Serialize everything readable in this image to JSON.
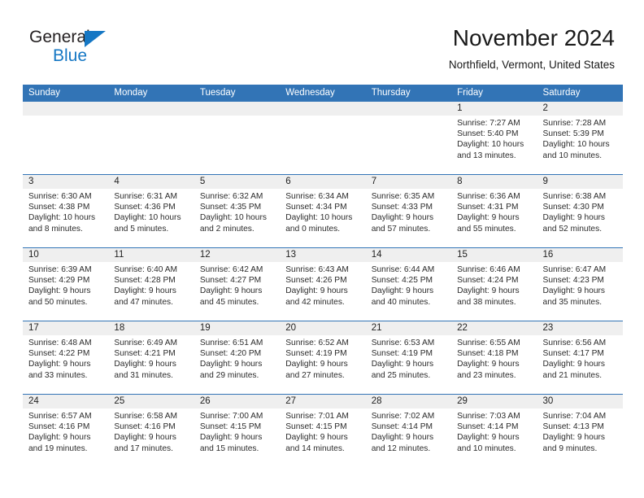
{
  "brand": {
    "name_top": "General",
    "name_bottom": "Blue",
    "color_blue": "#1577c4",
    "color_dark": "#231f20"
  },
  "header": {
    "title": "November 2024",
    "location": "Northfield, Vermont, United States"
  },
  "theme": {
    "header_blue": "#3274b6",
    "day_band_gray": "#efefef",
    "text_dark": "#2b2b2b"
  },
  "weekdays": [
    "Sunday",
    "Monday",
    "Tuesday",
    "Wednesday",
    "Thursday",
    "Friday",
    "Saturday"
  ],
  "weeks": [
    [
      {
        "day": "",
        "empty": true
      },
      {
        "day": "",
        "empty": true
      },
      {
        "day": "",
        "empty": true
      },
      {
        "day": "",
        "empty": true
      },
      {
        "day": "",
        "empty": true
      },
      {
        "day": "1",
        "sunrise": "Sunrise: 7:27 AM",
        "sunset": "Sunset: 5:40 PM",
        "daylight": "Daylight: 10 hours and 13 minutes."
      },
      {
        "day": "2",
        "sunrise": "Sunrise: 7:28 AM",
        "sunset": "Sunset: 5:39 PM",
        "daylight": "Daylight: 10 hours and 10 minutes."
      }
    ],
    [
      {
        "day": "3",
        "sunrise": "Sunrise: 6:30 AM",
        "sunset": "Sunset: 4:38 PM",
        "daylight": "Daylight: 10 hours and 8 minutes."
      },
      {
        "day": "4",
        "sunrise": "Sunrise: 6:31 AM",
        "sunset": "Sunset: 4:36 PM",
        "daylight": "Daylight: 10 hours and 5 minutes."
      },
      {
        "day": "5",
        "sunrise": "Sunrise: 6:32 AM",
        "sunset": "Sunset: 4:35 PM",
        "daylight": "Daylight: 10 hours and 2 minutes."
      },
      {
        "day": "6",
        "sunrise": "Sunrise: 6:34 AM",
        "sunset": "Sunset: 4:34 PM",
        "daylight": "Daylight: 10 hours and 0 minutes."
      },
      {
        "day": "7",
        "sunrise": "Sunrise: 6:35 AM",
        "sunset": "Sunset: 4:33 PM",
        "daylight": "Daylight: 9 hours and 57 minutes."
      },
      {
        "day": "8",
        "sunrise": "Sunrise: 6:36 AM",
        "sunset": "Sunset: 4:31 PM",
        "daylight": "Daylight: 9 hours and 55 minutes."
      },
      {
        "day": "9",
        "sunrise": "Sunrise: 6:38 AM",
        "sunset": "Sunset: 4:30 PM",
        "daylight": "Daylight: 9 hours and 52 minutes."
      }
    ],
    [
      {
        "day": "10",
        "sunrise": "Sunrise: 6:39 AM",
        "sunset": "Sunset: 4:29 PM",
        "daylight": "Daylight: 9 hours and 50 minutes."
      },
      {
        "day": "11",
        "sunrise": "Sunrise: 6:40 AM",
        "sunset": "Sunset: 4:28 PM",
        "daylight": "Daylight: 9 hours and 47 minutes."
      },
      {
        "day": "12",
        "sunrise": "Sunrise: 6:42 AM",
        "sunset": "Sunset: 4:27 PM",
        "daylight": "Daylight: 9 hours and 45 minutes."
      },
      {
        "day": "13",
        "sunrise": "Sunrise: 6:43 AM",
        "sunset": "Sunset: 4:26 PM",
        "daylight": "Daylight: 9 hours and 42 minutes."
      },
      {
        "day": "14",
        "sunrise": "Sunrise: 6:44 AM",
        "sunset": "Sunset: 4:25 PM",
        "daylight": "Daylight: 9 hours and 40 minutes."
      },
      {
        "day": "15",
        "sunrise": "Sunrise: 6:46 AM",
        "sunset": "Sunset: 4:24 PM",
        "daylight": "Daylight: 9 hours and 38 minutes."
      },
      {
        "day": "16",
        "sunrise": "Sunrise: 6:47 AM",
        "sunset": "Sunset: 4:23 PM",
        "daylight": "Daylight: 9 hours and 35 minutes."
      }
    ],
    [
      {
        "day": "17",
        "sunrise": "Sunrise: 6:48 AM",
        "sunset": "Sunset: 4:22 PM",
        "daylight": "Daylight: 9 hours and 33 minutes."
      },
      {
        "day": "18",
        "sunrise": "Sunrise: 6:49 AM",
        "sunset": "Sunset: 4:21 PM",
        "daylight": "Daylight: 9 hours and 31 minutes."
      },
      {
        "day": "19",
        "sunrise": "Sunrise: 6:51 AM",
        "sunset": "Sunset: 4:20 PM",
        "daylight": "Daylight: 9 hours and 29 minutes."
      },
      {
        "day": "20",
        "sunrise": "Sunrise: 6:52 AM",
        "sunset": "Sunset: 4:19 PM",
        "daylight": "Daylight: 9 hours and 27 minutes."
      },
      {
        "day": "21",
        "sunrise": "Sunrise: 6:53 AM",
        "sunset": "Sunset: 4:19 PM",
        "daylight": "Daylight: 9 hours and 25 minutes."
      },
      {
        "day": "22",
        "sunrise": "Sunrise: 6:55 AM",
        "sunset": "Sunset: 4:18 PM",
        "daylight": "Daylight: 9 hours and 23 minutes."
      },
      {
        "day": "23",
        "sunrise": "Sunrise: 6:56 AM",
        "sunset": "Sunset: 4:17 PM",
        "daylight": "Daylight: 9 hours and 21 minutes."
      }
    ],
    [
      {
        "day": "24",
        "sunrise": "Sunrise: 6:57 AM",
        "sunset": "Sunset: 4:16 PM",
        "daylight": "Daylight: 9 hours and 19 minutes."
      },
      {
        "day": "25",
        "sunrise": "Sunrise: 6:58 AM",
        "sunset": "Sunset: 4:16 PM",
        "daylight": "Daylight: 9 hours and 17 minutes."
      },
      {
        "day": "26",
        "sunrise": "Sunrise: 7:00 AM",
        "sunset": "Sunset: 4:15 PM",
        "daylight": "Daylight: 9 hours and 15 minutes."
      },
      {
        "day": "27",
        "sunrise": "Sunrise: 7:01 AM",
        "sunset": "Sunset: 4:15 PM",
        "daylight": "Daylight: 9 hours and 14 minutes."
      },
      {
        "day": "28",
        "sunrise": "Sunrise: 7:02 AM",
        "sunset": "Sunset: 4:14 PM",
        "daylight": "Daylight: 9 hours and 12 minutes."
      },
      {
        "day": "29",
        "sunrise": "Sunrise: 7:03 AM",
        "sunset": "Sunset: 4:14 PM",
        "daylight": "Daylight: 9 hours and 10 minutes."
      },
      {
        "day": "30",
        "sunrise": "Sunrise: 7:04 AM",
        "sunset": "Sunset: 4:13 PM",
        "daylight": "Daylight: 9 hours and 9 minutes."
      }
    ]
  ]
}
